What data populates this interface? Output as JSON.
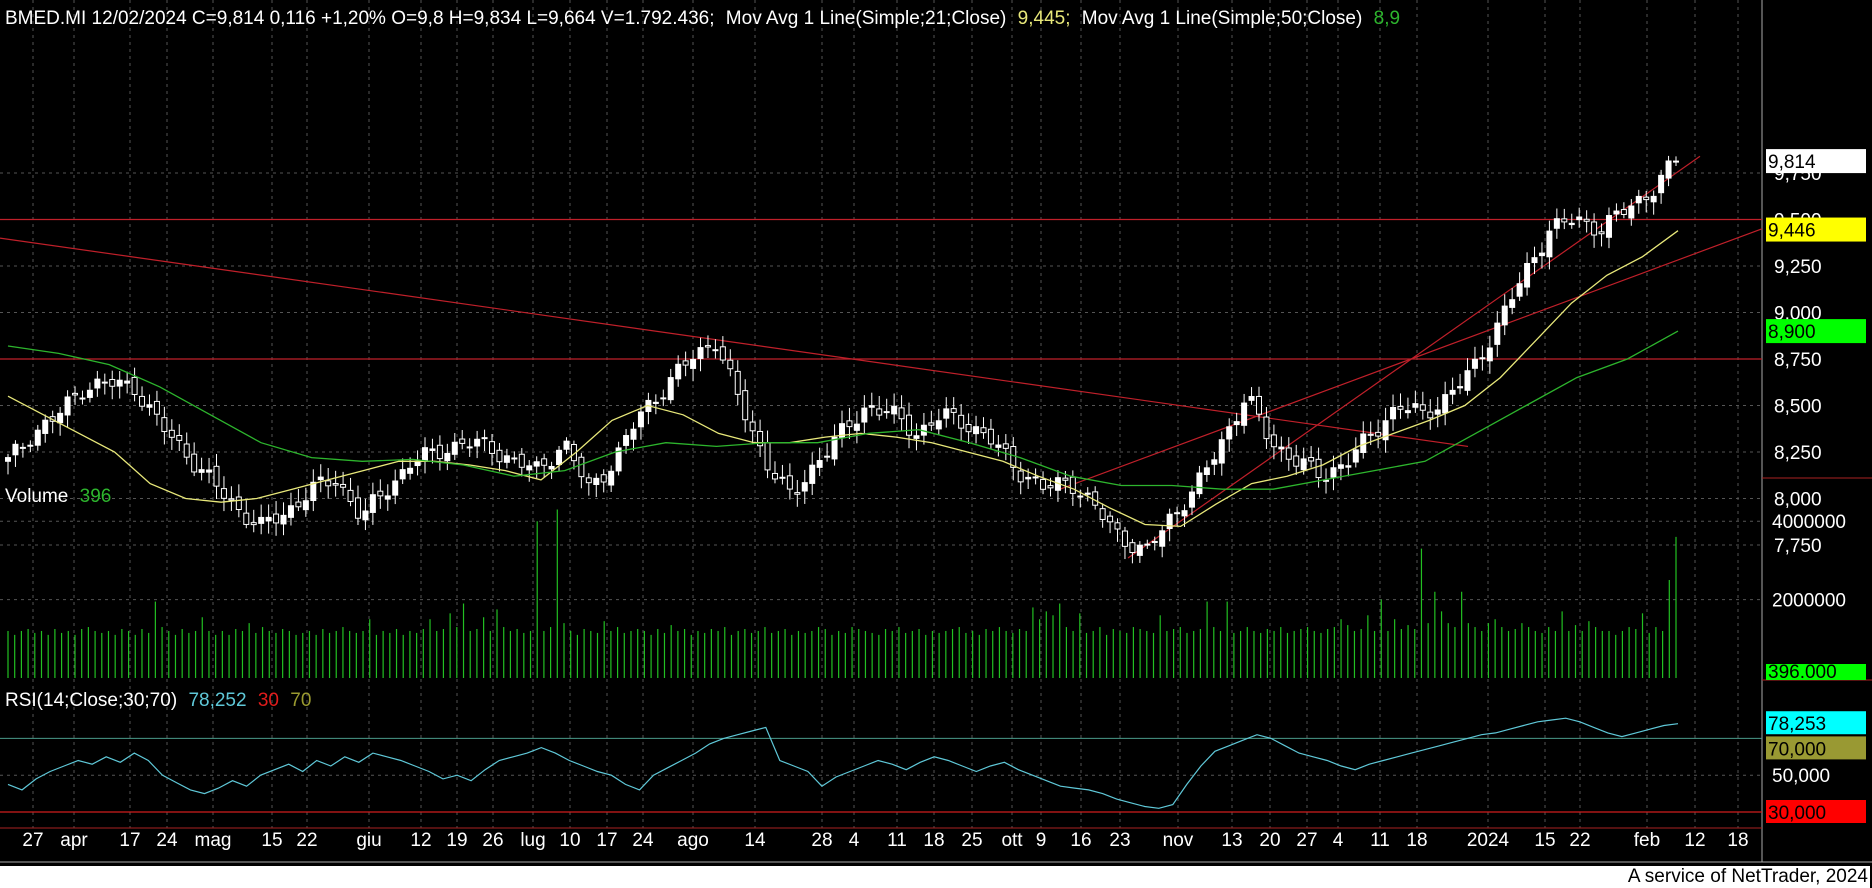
{
  "header": {
    "symbol_line": "BMED.MI 12/02/2024 C=9,814 0,116 +1,20% O=9,8 H=9,834 L=9,664 V=1.792.436;",
    "ma21_label": "Mov Avg 1 Line(Simple;21;Close)",
    "ma21_value": "9,445;",
    "ma50_label": "Mov Avg 1 Line(Simple;50;Close)",
    "ma50_value": "8,9"
  },
  "volume_panel": {
    "label": "Volume",
    "value": "396"
  },
  "rsi_panel": {
    "label": "RSI(14;Close;30;70)",
    "value": "78,252",
    "low": "30",
    "high": "70"
  },
  "footer": "A service of NetTrader, 2024",
  "colors": {
    "background": "#000000",
    "candle": "#ffffff",
    "ma21": "#e8e87a",
    "ma50": "#2db52d",
    "trendline": "#c0202a",
    "volume": "#22c022",
    "rsi": "#5fc8d8",
    "rsi_band_high": "#4a9a8a",
    "rsi_band_low": "#d01c1c",
    "grid": "#555555"
  },
  "chart_data": [
    {
      "type": "candlestick",
      "title": "BMED.MI",
      "y_ticks": [
        "7,750",
        "8,000",
        "8,250",
        "8,500",
        "8,750",
        "9,000",
        "9,250",
        "9,500",
        "9,750"
      ],
      "ylim": [
        7.6,
        9.9
      ],
      "price_markers": [
        {
          "label": "9,814",
          "value": 9.814,
          "bg": "#ffffff"
        },
        {
          "label": "9,446",
          "value": 9.446,
          "bg": "#ffff00"
        },
        {
          "label": "8,900",
          "value": 8.9,
          "bg": "#00ff00"
        }
      ],
      "horizontal_levels": [
        8.75,
        9.5
      ],
      "x_ticks": [
        "27",
        "apr",
        "17",
        "24",
        "mag",
        "15",
        "22",
        "giu",
        "12",
        "19",
        "26",
        "lug",
        "10",
        "17",
        "24",
        "ago",
        "14",
        "28",
        "4",
        "11",
        "18",
        "25",
        "ott",
        "9",
        "16",
        "23",
        "nov",
        "13",
        "20",
        "27",
        "4",
        "11",
        "18",
        "2024",
        "15",
        "22",
        "feb",
        "12",
        "18"
      ],
      "close_path": [
        8.2,
        8.35,
        8.45,
        8.6,
        8.62,
        8.6,
        8.4,
        8.25,
        8.1,
        7.95,
        7.85,
        7.92,
        8.05,
        8.1,
        7.9,
        8.05,
        8.2,
        8.25,
        8.3,
        8.28,
        8.2,
        8.15,
        8.3,
        8.05,
        8.2,
        8.45,
        8.6,
        8.75,
        8.85,
        8.5,
        8.2,
        8.0,
        8.2,
        8.35,
        8.5,
        8.45,
        8.35,
        8.45,
        8.4,
        8.3,
        8.15,
        8.05,
        8.1,
        7.95,
        7.8,
        7.7,
        7.9,
        8.05,
        8.3,
        8.55,
        8.3,
        8.2,
        8.12,
        8.2,
        8.35,
        8.5,
        8.45,
        8.55,
        8.7,
        8.95,
        9.2,
        9.45,
        9.5,
        9.45,
        9.55,
        9.65,
        9.814
      ],
      "ma21_path": [
        8.55,
        8.45,
        8.35,
        8.25,
        8.08,
        8.0,
        7.98,
        8.0,
        8.05,
        8.1,
        8.15,
        8.2,
        8.2,
        8.18,
        8.15,
        8.1,
        8.25,
        8.42,
        8.5,
        8.45,
        8.35,
        8.3,
        8.3,
        8.33,
        8.35,
        8.33,
        8.3,
        8.25,
        8.2,
        8.12,
        8.05,
        7.95,
        7.86,
        7.85,
        7.97,
        8.08,
        8.12,
        8.18,
        8.28,
        8.35,
        8.42,
        8.5,
        8.65,
        8.85,
        9.05,
        9.2,
        9.3,
        9.44
      ],
      "ma50_path": [
        8.82,
        8.78,
        8.72,
        8.6,
        8.45,
        8.3,
        8.22,
        8.2,
        8.21,
        8.18,
        8.12,
        8.15,
        8.25,
        8.3,
        8.28,
        8.3,
        8.3,
        8.35,
        8.37,
        8.3,
        8.22,
        8.12,
        8.07,
        8.07,
        8.05,
        8.05,
        8.1,
        8.15,
        8.2,
        8.35,
        8.5,
        8.65,
        8.75,
        8.9
      ],
      "trendlines": [
        {
          "from_value": 9.4,
          "to_value": 8.28
        },
        {
          "from_value": 7.68,
          "to_value": 9.84
        },
        {
          "from_value": 8.05,
          "to_value": 9.45
        }
      ]
    },
    {
      "type": "bar",
      "title": "Volume",
      "y_ticks": [
        "2000000",
        "4000000"
      ],
      "ylim": [
        0,
        4600000
      ],
      "last_marker": "396.000",
      "values": [
        1200000,
        1100000,
        1200000,
        1250000,
        1150000,
        1200000,
        1100000,
        1250000,
        1150000,
        1200000,
        1100000,
        1250000,
        1300000,
        1200000,
        1150000,
        1200000,
        1100000,
        1250000,
        1200000,
        1100000,
        1250000,
        1150000,
        1950000,
        1300000,
        1200000,
        1100000,
        1250000,
        1150000,
        1200000,
        1550000,
        1200000,
        1100000,
        1200000,
        1100000,
        1250000,
        1200000,
        1400000,
        1150000,
        1300000,
        1200000,
        1150000,
        1250000,
        1200000,
        1100000,
        1150000,
        1200000,
        1100000,
        1250000,
        1150000,
        1200000,
        1300000,
        1200000,
        1150000,
        1200000,
        1500000,
        1100000,
        1200000,
        1150000,
        1250000,
        1100000,
        1200000,
        1150000,
        1250000,
        1500000,
        1200000,
        1250000,
        1650000,
        1300000,
        1900000,
        1200000,
        1250000,
        1550000,
        1200000,
        1750000,
        1300000,
        1200000,
        1250000,
        1150000,
        1200000,
        4000000,
        1200000,
        1300000,
        4300000,
        1400000,
        1200000,
        1100000,
        1250000,
        1200000,
        1150000,
        1450000,
        1200000,
        1300000,
        1150000,
        1200000,
        1250000,
        1200000,
        1100000,
        1250000,
        1150000,
        1350000,
        1200000,
        1250000,
        1100000,
        1200000,
        1150000,
        1250000,
        1200000,
        1300000,
        1100000,
        1200000,
        1250000,
        1150000,
        1200000,
        1300000,
        1150000,
        1200000,
        1250000,
        1100000,
        1200000,
        1150000,
        1200000,
        1300000,
        1250000,
        1100000,
        1200000,
        1150000,
        1300000,
        1250000,
        1200000,
        1150000,
        1100000,
        1250000,
        1200000,
        1300000,
        1150000,
        1200000,
        1250000,
        1100000,
        1200000,
        1150000,
        1200000,
        1250000,
        1300000,
        1150000,
        1200000,
        1100000,
        1250000,
        1200000,
        1300000,
        1200000,
        1150000,
        1250000,
        1200000,
        1800000,
        1500000,
        1700000,
        1600000,
        1900000,
        1300000,
        1200000,
        1650000,
        1150000,
        1200000,
        1300000,
        1100000,
        1250000,
        1200000,
        1150000,
        1300000,
        1250000,
        1200000,
        1150000,
        1600000,
        1200000,
        1250000,
        1300000,
        1150000,
        1200000,
        1250000,
        1950000,
        1300000,
        1200000,
        1950000,
        1150000,
        1200000,
        1300000,
        1200000,
        1150000,
        1250000,
        1200000,
        1300000,
        1150000,
        1200000,
        1250000,
        1300000,
        1200000,
        1150000,
        1250000,
        1300000,
        1500000,
        1350000,
        1200000,
        1250000,
        1600000,
        1200000,
        2000000,
        1200000,
        1500000,
        1250000,
        1350000,
        1250000,
        3300000,
        1400000,
        2200000,
        1700000,
        1400000,
        1300000,
        2200000,
        1400000,
        1300000,
        1200000,
        1400000,
        1500000,
        1300000,
        1200000,
        1250000,
        1400000,
        1300000,
        1200000,
        1150000,
        1300000,
        1200000,
        1700000,
        1200000,
        1350000,
        1200000,
        1450000,
        1300000,
        1200000,
        1200000,
        1100000,
        1200000,
        1300000,
        1250000,
        1650000,
        1150000,
        1300000,
        1200000,
        2500000,
        3600000
      ]
    },
    {
      "type": "line",
      "title": "RSI(14;Close;30;70)",
      "ylim": [
        25,
        85
      ],
      "y_ticks": [
        "50,000"
      ],
      "bands": [
        {
          "label": "70,000",
          "value": 70
        },
        {
          "label": "30,000",
          "value": 30
        }
      ],
      "last_marker": "78,253",
      "values": [
        45,
        42,
        48,
        52,
        55,
        58,
        56,
        60,
        57,
        62,
        58,
        50,
        46,
        42,
        40,
        43,
        47,
        44,
        50,
        53,
        56,
        52,
        58,
        55,
        60,
        57,
        62,
        60,
        58,
        55,
        52,
        48,
        50,
        47,
        53,
        58,
        60,
        62,
        65,
        62,
        58,
        55,
        52,
        50,
        45,
        42,
        50,
        54,
        58,
        62,
        67,
        70,
        72,
        74,
        76,
        58,
        55,
        52,
        44,
        49,
        52,
        55,
        58,
        56,
        53,
        57,
        60,
        58,
        55,
        52,
        55,
        57,
        53,
        50,
        47,
        44,
        43,
        42,
        40,
        37,
        35,
        33,
        32,
        34,
        45,
        55,
        63,
        66,
        69,
        72,
        70,
        66,
        62,
        60,
        58,
        55,
        53,
        56,
        58,
        60,
        62,
        64,
        66,
        68,
        70,
        72,
        73,
        75,
        77,
        79,
        80,
        81,
        79,
        76,
        73,
        71,
        73,
        75,
        77,
        78
      ]
    }
  ]
}
